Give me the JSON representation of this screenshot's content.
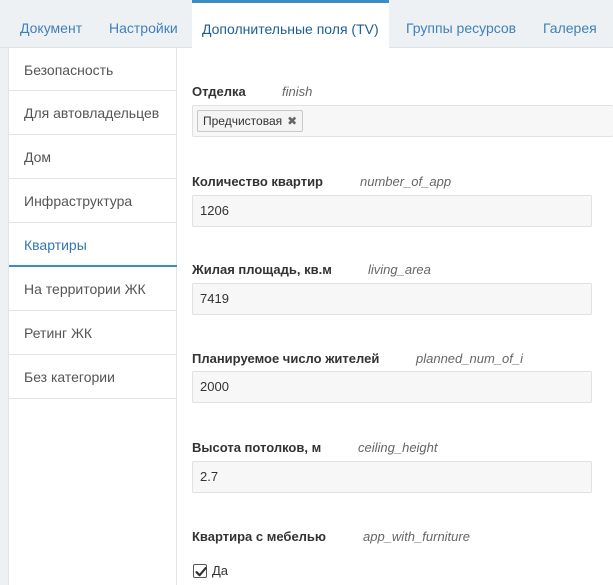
{
  "tabs": [
    {
      "label": "Документ"
    },
    {
      "label": "Настройки"
    },
    {
      "label": "Дополнительные поля (TV)",
      "active": true
    },
    {
      "label": "Группы ресурсов"
    },
    {
      "label": "Галерея"
    }
  ],
  "categories": [
    {
      "label": "Безопасность"
    },
    {
      "label": "Для автовладельцев"
    },
    {
      "label": "Дом"
    },
    {
      "label": "Инфраструктура"
    },
    {
      "label": "Квартиры",
      "active": true
    },
    {
      "label": "На территории ЖК"
    },
    {
      "label": "Ретинг ЖК"
    },
    {
      "label": "Без категории"
    }
  ],
  "fields": {
    "finish": {
      "label": "Отделка",
      "key": "finish",
      "tag": "Предчистовая"
    },
    "number_of_app": {
      "label": "Количество квартир",
      "key": "number_of_app",
      "value": "1206"
    },
    "living_area": {
      "label": "Жилая площадь, кв.м",
      "key": "living_area",
      "value": "7419"
    },
    "planned_num": {
      "label": "Планируемое число жителей",
      "key": "planned_num_of_i",
      "value": "2000"
    },
    "ceiling_height": {
      "label": "Высота потолков, м",
      "key": "ceiling_height",
      "value": "2.7"
    },
    "furniture": {
      "label": "Квартира с мебелью",
      "key": "app_with_furniture",
      "option": "Да",
      "checked": true
    }
  },
  "colors": {
    "accent": "#3c8dc4",
    "link": "#3f80b8",
    "tabbar_bg": "#eef1f3"
  }
}
